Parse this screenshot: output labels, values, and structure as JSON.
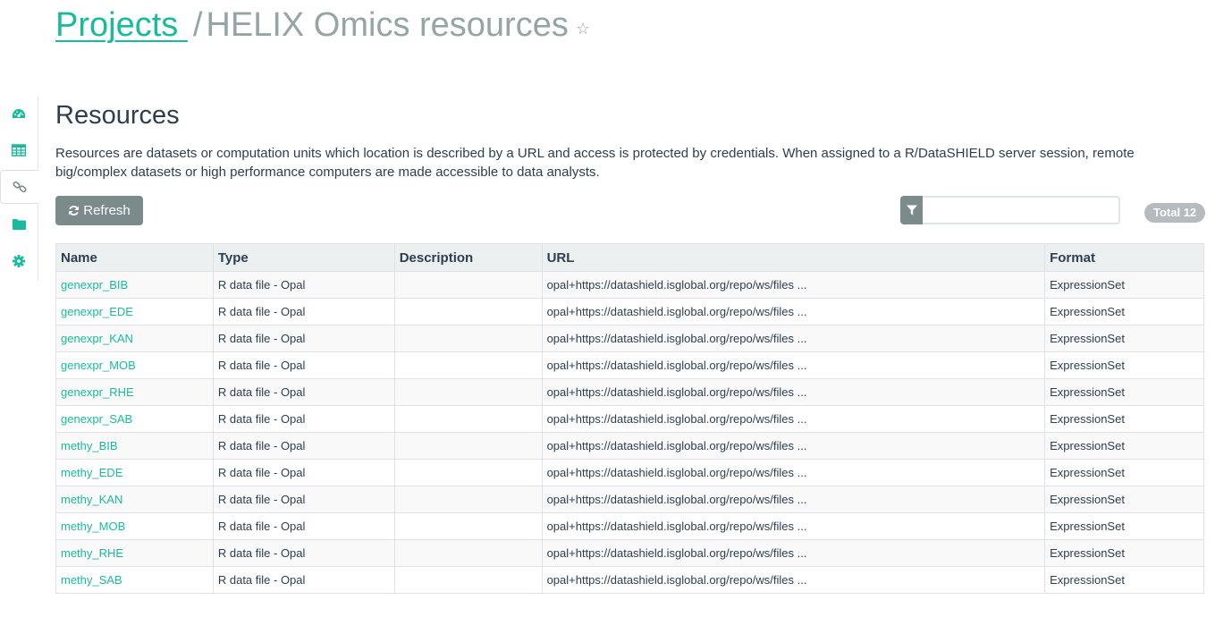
{
  "breadcrumb": {
    "parent": "Projects",
    "separator": "/",
    "current": "HELIX Omics resources",
    "star_icon": "star-outline-icon"
  },
  "sidenav": {
    "items": [
      {
        "icon": "dashboard-icon",
        "active": false
      },
      {
        "icon": "table-icon",
        "active": false
      },
      {
        "icon": "link-icon",
        "active": true
      },
      {
        "icon": "folder-icon",
        "active": false
      },
      {
        "icon": "gear-icon",
        "active": false
      }
    ]
  },
  "section": {
    "title": "Resources",
    "description": "Resources are datasets or computation units which location is described by a URL and access is protected by credentials. When assigned to a R/DataSHIELD server session, remote big/complex datasets or high performance computers are made accessible to data analysts."
  },
  "toolbar": {
    "refresh_label": "Refresh",
    "filter_value": "",
    "filter_placeholder": "",
    "total_label": "Total 12"
  },
  "table": {
    "headers": {
      "name": "Name",
      "type": "Type",
      "description": "Description",
      "url": "URL",
      "format": "Format"
    },
    "rows": [
      {
        "name": "genexpr_BIB",
        "type": "R data file - Opal",
        "description": "",
        "url": "opal+https://datashield.isglobal.org/repo/ws/files ...",
        "format": "ExpressionSet"
      },
      {
        "name": "genexpr_EDE",
        "type": "R data file - Opal",
        "description": "",
        "url": "opal+https://datashield.isglobal.org/repo/ws/files ...",
        "format": "ExpressionSet"
      },
      {
        "name": "genexpr_KAN",
        "type": "R data file - Opal",
        "description": "",
        "url": "opal+https://datashield.isglobal.org/repo/ws/files ...",
        "format": "ExpressionSet"
      },
      {
        "name": "genexpr_MOB",
        "type": "R data file - Opal",
        "description": "",
        "url": "opal+https://datashield.isglobal.org/repo/ws/files ...",
        "format": "ExpressionSet"
      },
      {
        "name": "genexpr_RHE",
        "type": "R data file - Opal",
        "description": "",
        "url": "opal+https://datashield.isglobal.org/repo/ws/files ...",
        "format": "ExpressionSet"
      },
      {
        "name": "genexpr_SAB",
        "type": "R data file - Opal",
        "description": "",
        "url": "opal+https://datashield.isglobal.org/repo/ws/files ...",
        "format": "ExpressionSet"
      },
      {
        "name": "methy_BIB",
        "type": "R data file - Opal",
        "description": "",
        "url": "opal+https://datashield.isglobal.org/repo/ws/files ...",
        "format": "ExpressionSet"
      },
      {
        "name": "methy_EDE",
        "type": "R data file - Opal",
        "description": "",
        "url": "opal+https://datashield.isglobal.org/repo/ws/files ...",
        "format": "ExpressionSet"
      },
      {
        "name": "methy_KAN",
        "type": "R data file - Opal",
        "description": "",
        "url": "opal+https://datashield.isglobal.org/repo/ws/files ...",
        "format": "ExpressionSet"
      },
      {
        "name": "methy_MOB",
        "type": "R data file - Opal",
        "description": "",
        "url": "opal+https://datashield.isglobal.org/repo/ws/files ...",
        "format": "ExpressionSet"
      },
      {
        "name": "methy_RHE",
        "type": "R data file - Opal",
        "description": "",
        "url": "opal+https://datashield.isglobal.org/repo/ws/files ...",
        "format": "ExpressionSet"
      },
      {
        "name": "methy_SAB",
        "type": "R data file - Opal",
        "description": "",
        "url": "opal+https://datashield.isglobal.org/repo/ws/files ...",
        "format": "ExpressionSet"
      }
    ]
  },
  "colors": {
    "accent": "#18bc9c",
    "muted": "#95a5a6",
    "button": "#7b8a8b",
    "text": "#2c3e50"
  }
}
